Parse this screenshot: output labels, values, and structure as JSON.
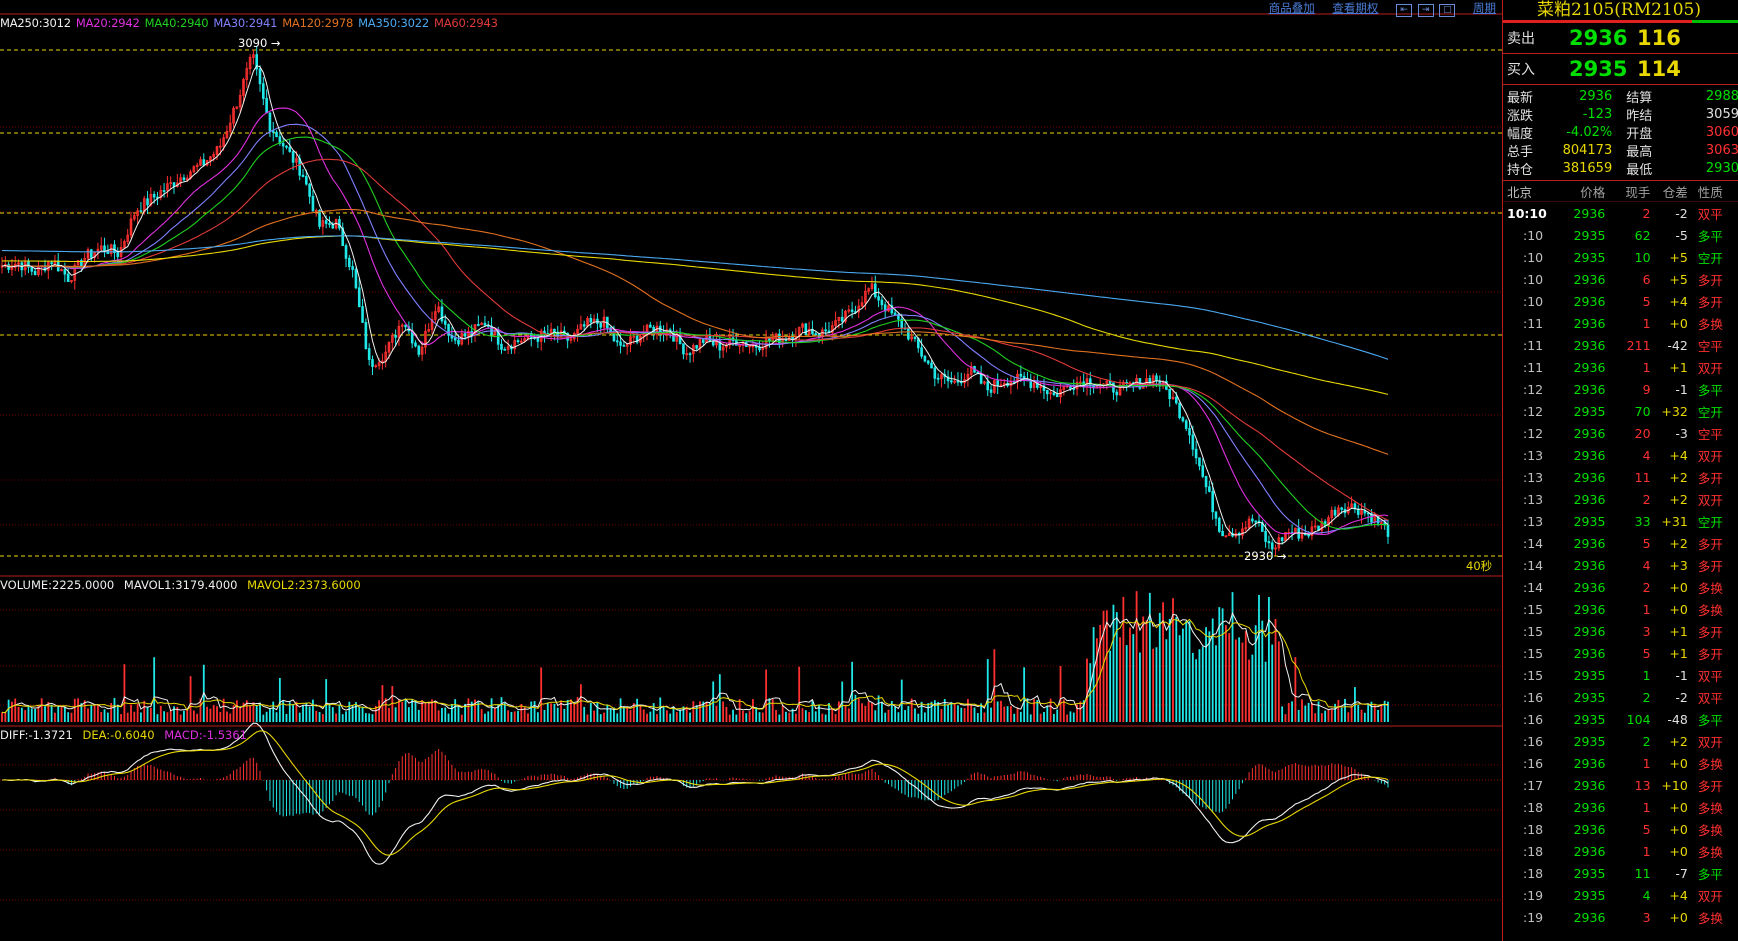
{
  "ma_legend": [
    {
      "text": "MA250:3012",
      "color": "#f0f0f0"
    },
    {
      "text": "MA20:2942",
      "color": "#e030e0"
    },
    {
      "text": "MA40:2940",
      "color": "#20d020"
    },
    {
      "text": "MA30:2941",
      "color": "#8080ff"
    },
    {
      "text": "MA120:2978",
      "color": "#e07020"
    },
    {
      "text": "MA350:3022",
      "color": "#4aa8f0"
    },
    {
      "text": "MA60:2943",
      "color": "#e03a3a"
    }
  ],
  "top_links": [
    "商品叠加",
    "查看期权",
    "周期"
  ],
  "price_labels": {
    "high": "3090",
    "low": "2930"
  },
  "seconds_label": "40秒",
  "volume_legend": {
    "vol": "VOLUME:2225.0000",
    "mavol1": "MAVOL1:3179.4000",
    "mavol2": "MAVOL2:2373.6000"
  },
  "macd_legend": {
    "diff": "DIFF:-1.3721",
    "dea": "DEA:-0.6040",
    "macd": "MACD:-1.5361"
  },
  "colors": {
    "up": "#ff3030",
    "down": "#20e8e8",
    "neutral": "#f0f0f0",
    "grid": "#8a0000",
    "level": "#e8d800"
  },
  "chart_data": {
    "type": "candlestick",
    "price_levels": [
      3090,
      3060,
      3030,
      3000,
      2970,
      2940,
      2930
    ],
    "high": 3090,
    "low": 2930,
    "close_path": [
      3022,
      3023,
      3020,
      3024,
      3018,
      3025,
      3028,
      3026,
      3040,
      3044,
      3048,
      3052,
      3055,
      3060,
      3074,
      3090,
      3068,
      3060,
      3052,
      3035,
      3036,
      3020,
      2990,
      2994,
      3005,
      2994,
      3010,
      2998,
      3000,
      3004,
      2996,
      2998,
      2999,
      3000,
      2998,
      3003,
      3004,
      2995,
      2999,
      3002,
      3001,
      2994,
      2998,
      2996,
      2998,
      2996,
      2998,
      2999,
      3002,
      3000,
      3003,
      3008,
      3015,
      3008,
      3002,
      2994,
      2986,
      2984,
      2988,
      2982,
      2985,
      2985,
      2984,
      2980,
      2984,
      2985,
      2983,
      2982,
      2984,
      2986,
      2980,
      2970,
      2952,
      2936,
      2936,
      2940,
      2930,
      2936,
      2935,
      2938,
      2944,
      2944,
      2941,
      2936
    ]
  },
  "panel": {
    "title": "菜粕2105(RM2105)",
    "sell": {
      "label": "卖出",
      "price": "2936",
      "qty": "116"
    },
    "buy": {
      "label": "买入",
      "price": "2935",
      "qty": "114"
    },
    "stats": [
      {
        "k1": "最新",
        "v1": "2936",
        "c1": "#00e000",
        "k2": "结算",
        "v2": "2988",
        "c2": "#00e000"
      },
      {
        "k1": "涨跌",
        "v1": "-123",
        "c1": "#00e000",
        "k2": "昨结",
        "v2": "3059",
        "c2": "#e0e0e0"
      },
      {
        "k1": "幅度",
        "v1": "-4.02%",
        "c1": "#00e000",
        "k2": "开盘",
        "v2": "3060",
        "c2": "#ff3030"
      },
      {
        "k1": "总手",
        "v1": "804173",
        "c1": "#e8d800",
        "k2": "最高",
        "v2": "3063",
        "c2": "#ff3030"
      },
      {
        "k1": "持仓",
        "v1": "381659",
        "c1": "#e8d800",
        "k2": "最低",
        "v2": "2930",
        "c2": "#00e000"
      }
    ],
    "headers": {
      "time": "北京",
      "price": "价格",
      "qty": "现手",
      "chg": "仓差",
      "type": "性质"
    },
    "ticks": [
      {
        "t": "10:10",
        "p": "2936",
        "q": "2",
        "c": "-2",
        "y": "双平"
      },
      {
        "t": ":10",
        "p": "2935",
        "q": "62",
        "c": "-5",
        "y": "多平"
      },
      {
        "t": ":10",
        "p": "2935",
        "q": "10",
        "c": "+5",
        "y": "空开"
      },
      {
        "t": ":10",
        "p": "2936",
        "q": "6",
        "c": "+5",
        "y": "多开"
      },
      {
        "t": ":10",
        "p": "2936",
        "q": "5",
        "c": "+4",
        "y": "多开"
      },
      {
        "t": ":11",
        "p": "2936",
        "q": "1",
        "c": "+0",
        "y": "多换"
      },
      {
        "t": ":11",
        "p": "2936",
        "q": "211",
        "c": "-42",
        "y": "空平"
      },
      {
        "t": ":11",
        "p": "2936",
        "q": "1",
        "c": "+1",
        "y": "双开"
      },
      {
        "t": ":12",
        "p": "2936",
        "q": "9",
        "c": "-1",
        "y": "多平"
      },
      {
        "t": ":12",
        "p": "2935",
        "q": "70",
        "c": "+32",
        "y": "空开"
      },
      {
        "t": ":12",
        "p": "2936",
        "q": "20",
        "c": "-3",
        "y": "空平"
      },
      {
        "t": ":13",
        "p": "2936",
        "q": "4",
        "c": "+4",
        "y": "双开"
      },
      {
        "t": ":13",
        "p": "2936",
        "q": "11",
        "c": "+2",
        "y": "多开"
      },
      {
        "t": ":13",
        "p": "2936",
        "q": "2",
        "c": "+2",
        "y": "双开"
      },
      {
        "t": ":13",
        "p": "2935",
        "q": "33",
        "c": "+31",
        "y": "空开"
      },
      {
        "t": ":14",
        "p": "2936",
        "q": "5",
        "c": "+2",
        "y": "多开"
      },
      {
        "t": ":14",
        "p": "2936",
        "q": "4",
        "c": "+3",
        "y": "多开"
      },
      {
        "t": ":14",
        "p": "2936",
        "q": "2",
        "c": "+0",
        "y": "多换"
      },
      {
        "t": ":15",
        "p": "2936",
        "q": "1",
        "c": "+0",
        "y": "多换"
      },
      {
        "t": ":15",
        "p": "2936",
        "q": "3",
        "c": "+1",
        "y": "多开"
      },
      {
        "t": ":15",
        "p": "2936",
        "q": "5",
        "c": "+1",
        "y": "多开"
      },
      {
        "t": ":15",
        "p": "2935",
        "q": "1",
        "c": "-1",
        "y": "双平"
      },
      {
        "t": ":16",
        "p": "2935",
        "q": "2",
        "c": "-2",
        "y": "双平"
      },
      {
        "t": ":16",
        "p": "2935",
        "q": "104",
        "c": "-48",
        "y": "多平"
      },
      {
        "t": ":16",
        "p": "2935",
        "q": "2",
        "c": "+2",
        "y": "双开"
      },
      {
        "t": ":16",
        "p": "2936",
        "q": "1",
        "c": "+0",
        "y": "多换"
      },
      {
        "t": ":17",
        "p": "2936",
        "q": "13",
        "c": "+10",
        "y": "多开"
      },
      {
        "t": ":18",
        "p": "2936",
        "q": "1",
        "c": "+0",
        "y": "多换"
      },
      {
        "t": ":18",
        "p": "2936",
        "q": "5",
        "c": "+0",
        "y": "多换"
      },
      {
        "t": ":18",
        "p": "2936",
        "q": "1",
        "c": "+0",
        "y": "多换"
      },
      {
        "t": ":18",
        "p": "2935",
        "q": "11",
        "c": "-7",
        "y": "多平"
      },
      {
        "t": ":19",
        "p": "2935",
        "q": "4",
        "c": "+4",
        "y": "双开"
      },
      {
        "t": ":19",
        "p": "2936",
        "q": "3",
        "c": "+0",
        "y": "多换"
      }
    ]
  }
}
